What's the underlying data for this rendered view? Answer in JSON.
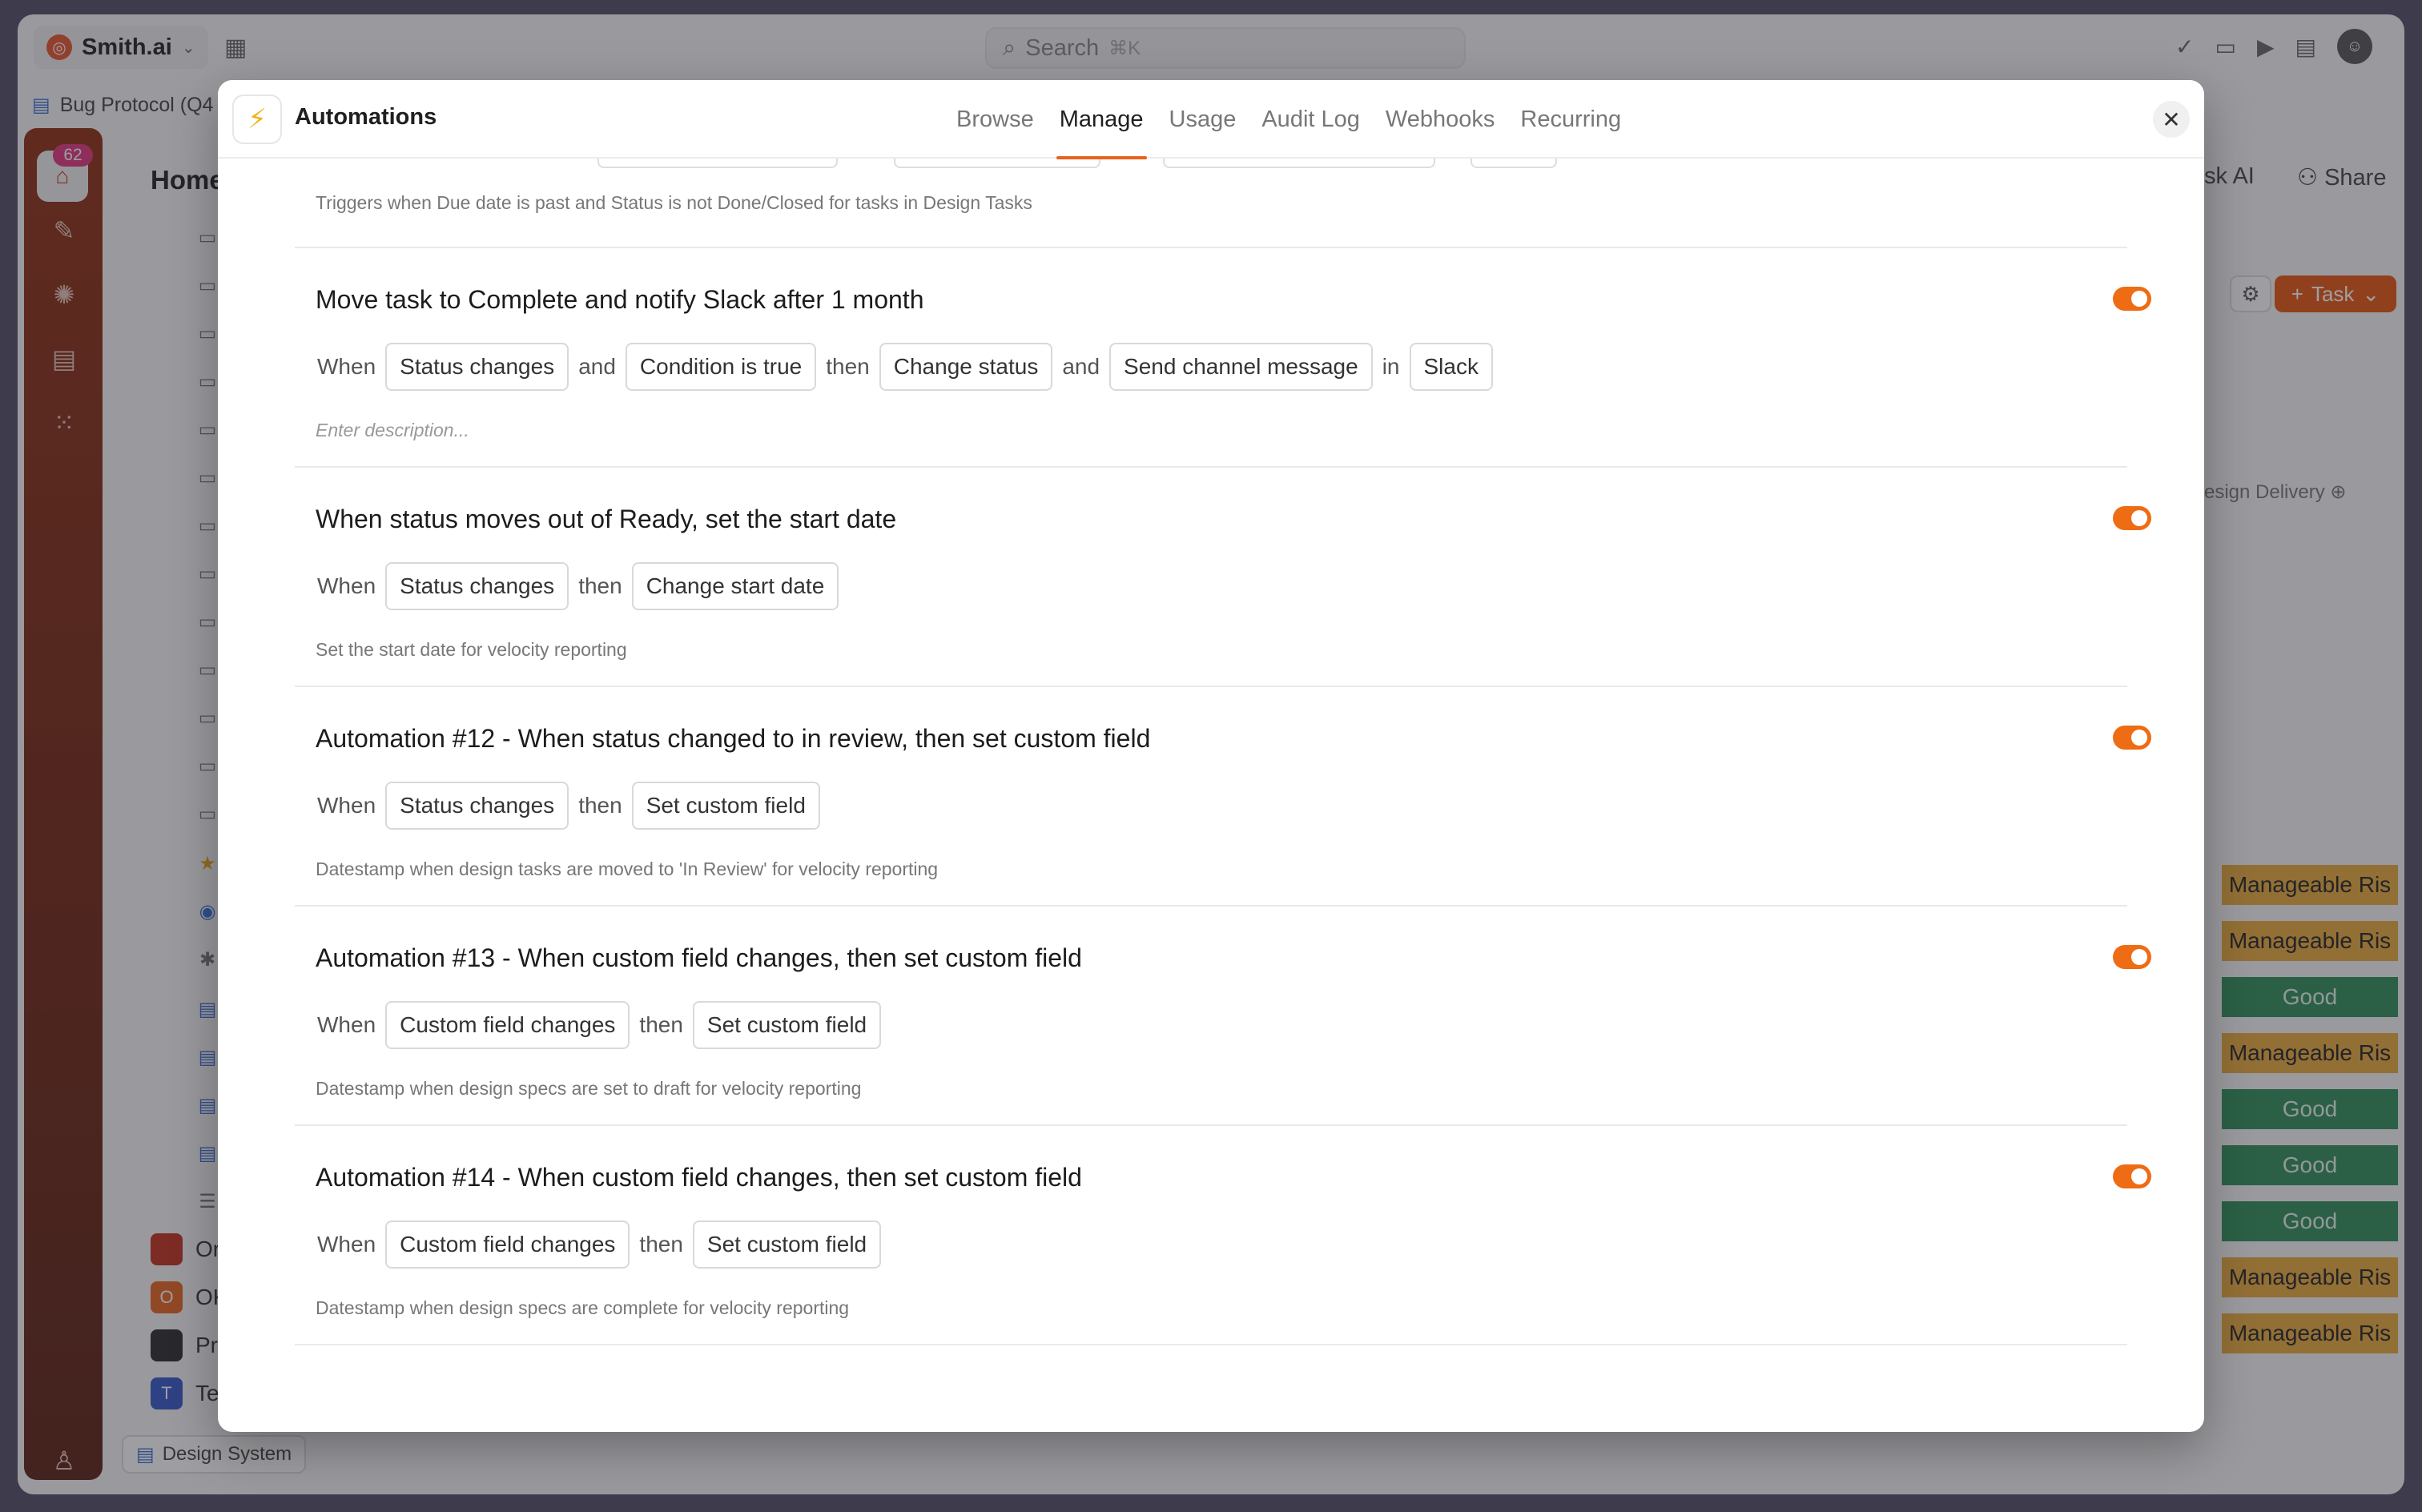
{
  "app": {
    "workspace_name": "Smith.ai",
    "search_placeholder": "Search",
    "search_shortcut": "⌘K",
    "open_tab": "Bug Protocol (Q4",
    "notification_count": "62",
    "sidebar_title": "Home",
    "sidebar_entries": [
      {
        "initial": "",
        "label": "Org",
        "color": "#c2311d"
      },
      {
        "initial": "O",
        "label": "OKI",
        "color": "#e8631c"
      },
      {
        "initial": "",
        "label": "Pro",
        "color": "#2b2b2b"
      },
      {
        "initial": "T",
        "label": "Tes",
        "color": "#3456c8"
      }
    ],
    "footer_tab": "Design System",
    "header_ask_ai": "sk AI",
    "header_share": "Share",
    "task_button": "Task",
    "column_label": "esign Delivery",
    "status_pills": [
      "Manageable Ris",
      "Manageable Ris",
      "Good",
      "Manageable Ris",
      "Good",
      "Good",
      "Good",
      "Manageable Ris",
      "Manageable Ris"
    ]
  },
  "modal": {
    "title": "Automations",
    "tabs": [
      "Browse",
      "Manage",
      "Usage",
      "Audit Log",
      "Webhooks",
      "Recurring"
    ],
    "active_tab": "Manage",
    "partial_description": "Triggers when Due date is past and Status is not Done/Closed for tasks in Design Tasks",
    "automations": [
      {
        "title": "Move task to Complete and notify Slack after 1 month",
        "enabled": true,
        "flow": [
          "When",
          "[Status changes]",
          "and",
          "[Condition is true]",
          "then",
          "[Change status]",
          "and",
          "[Send channel message]",
          "in",
          "[Slack]"
        ],
        "description": "Enter description...",
        "description_is_placeholder": true
      },
      {
        "title": "When status moves out of Ready, set the start date",
        "enabled": true,
        "flow": [
          "When",
          "[Status changes]",
          "then",
          "[Change start date]"
        ],
        "description": "Set the start date for velocity reporting",
        "description_is_placeholder": false
      },
      {
        "title": "Automation #12 - When status changed to in review, then set custom field",
        "enabled": true,
        "flow": [
          "When",
          "[Status changes]",
          "then",
          "[Set custom field]"
        ],
        "description": "Datestamp when design tasks are moved to 'In Review' for velocity reporting",
        "description_is_placeholder": false
      },
      {
        "title": "Automation #13 - When custom field changes, then set custom field",
        "enabled": true,
        "flow": [
          "When",
          "[Custom field changes]",
          "then",
          "[Set custom field]"
        ],
        "description": "Datestamp when design specs are set to draft for velocity reporting",
        "description_is_placeholder": false
      },
      {
        "title": "Automation #14 - When custom field changes, then set custom field",
        "enabled": true,
        "flow": [
          "When",
          "[Custom field changes]",
          "then",
          "[Set custom field]"
        ],
        "description": "Datestamp when design specs are complete for velocity reporting",
        "description_is_placeholder": false
      }
    ]
  },
  "colors": {
    "accent": "#ee6c14",
    "bolt": "#f0b420",
    "risk": "#e9a93a",
    "good": "#2f8f58"
  },
  "icons": {
    "modal_logo": "lightning-bolt-icon",
    "close": "close-icon",
    "toggle": "toggle-on-icon"
  }
}
